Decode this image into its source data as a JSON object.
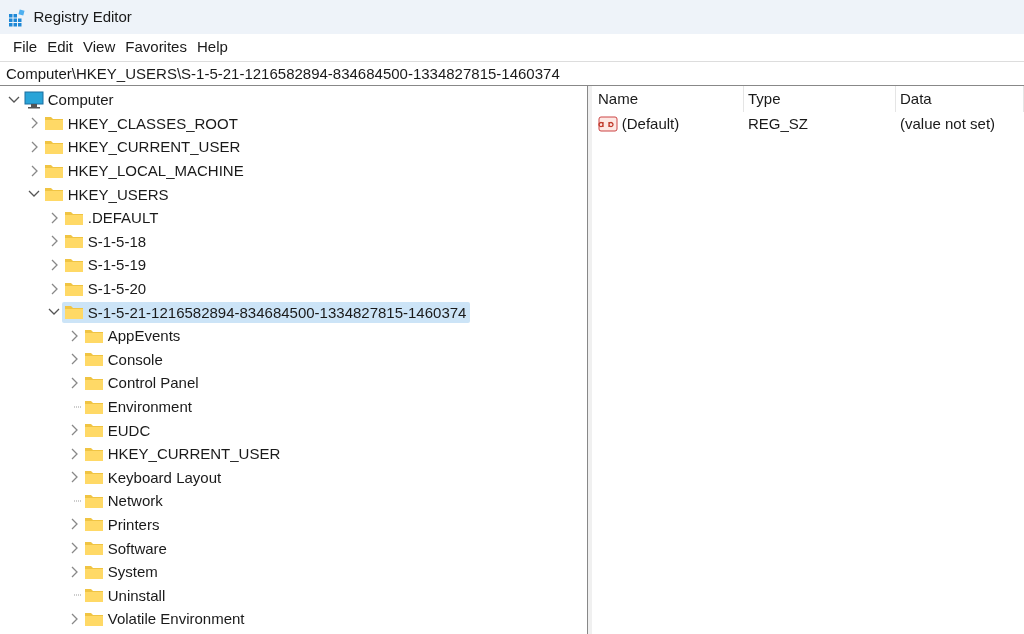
{
  "window": {
    "title": "Registry Editor"
  },
  "menu": [
    "File",
    "Edit",
    "View",
    "Favorites",
    "Help"
  ],
  "address": "Computer\\HKEY_USERS\\S-1-5-21-1216582894-834684500-1334827815-1460374",
  "tree": [
    {
      "label": "Computer",
      "kind": "computer",
      "expanded": true,
      "selected": false,
      "children": [
        {
          "label": "HKEY_CLASSES_ROOT",
          "kind": "folder",
          "expanded": false,
          "selected": false
        },
        {
          "label": "HKEY_CURRENT_USER",
          "kind": "folder",
          "expanded": false,
          "selected": false
        },
        {
          "label": "HKEY_LOCAL_MACHINE",
          "kind": "folder",
          "expanded": false,
          "selected": false
        },
        {
          "label": "HKEY_USERS",
          "kind": "folder",
          "expanded": true,
          "selected": false,
          "children": [
            {
              "label": ".DEFAULT",
              "kind": "folder",
              "expanded": false,
              "selected": false
            },
            {
              "label": "S-1-5-18",
              "kind": "folder",
              "expanded": false,
              "selected": false
            },
            {
              "label": "S-1-5-19",
              "kind": "folder",
              "expanded": false,
              "selected": false
            },
            {
              "label": "S-1-5-20",
              "kind": "folder",
              "expanded": false,
              "selected": false
            },
            {
              "label": "S-1-5-21-1216582894-834684500-1334827815-1460374",
              "kind": "folder",
              "expanded": true,
              "selected": true,
              "children": [
                {
                  "label": "AppEvents",
                  "kind": "folder",
                  "expanded": false,
                  "selected": false
                },
                {
                  "label": "Console",
                  "kind": "folder",
                  "expanded": false,
                  "selected": false
                },
                {
                  "label": "Control Panel",
                  "kind": "folder",
                  "expanded": false,
                  "selected": false
                },
                {
                  "label": "Environment",
                  "kind": "leaf",
                  "selected": false
                },
                {
                  "label": "EUDC",
                  "kind": "folder",
                  "expanded": false,
                  "selected": false
                },
                {
                  "label": "HKEY_CURRENT_USER",
                  "kind": "folder",
                  "expanded": false,
                  "selected": false
                },
                {
                  "label": "Keyboard Layout",
                  "kind": "folder",
                  "expanded": false,
                  "selected": false
                },
                {
                  "label": "Network",
                  "kind": "leaf",
                  "selected": false
                },
                {
                  "label": "Printers",
                  "kind": "folder",
                  "expanded": false,
                  "selected": false
                },
                {
                  "label": "Software",
                  "kind": "folder",
                  "expanded": false,
                  "selected": false
                },
                {
                  "label": "System",
                  "kind": "folder",
                  "expanded": false,
                  "selected": false
                },
                {
                  "label": "Uninstall",
                  "kind": "leaf",
                  "selected": false
                },
                {
                  "label": "Volatile Environment",
                  "kind": "folder",
                  "expanded": false,
                  "selected": false
                }
              ]
            }
          ]
        }
      ]
    }
  ],
  "values": {
    "columns": [
      "Name",
      "Type",
      "Data"
    ],
    "rows": [
      {
        "name": "(Default)",
        "type": "REG_SZ",
        "data": "(value not set)"
      }
    ]
  }
}
